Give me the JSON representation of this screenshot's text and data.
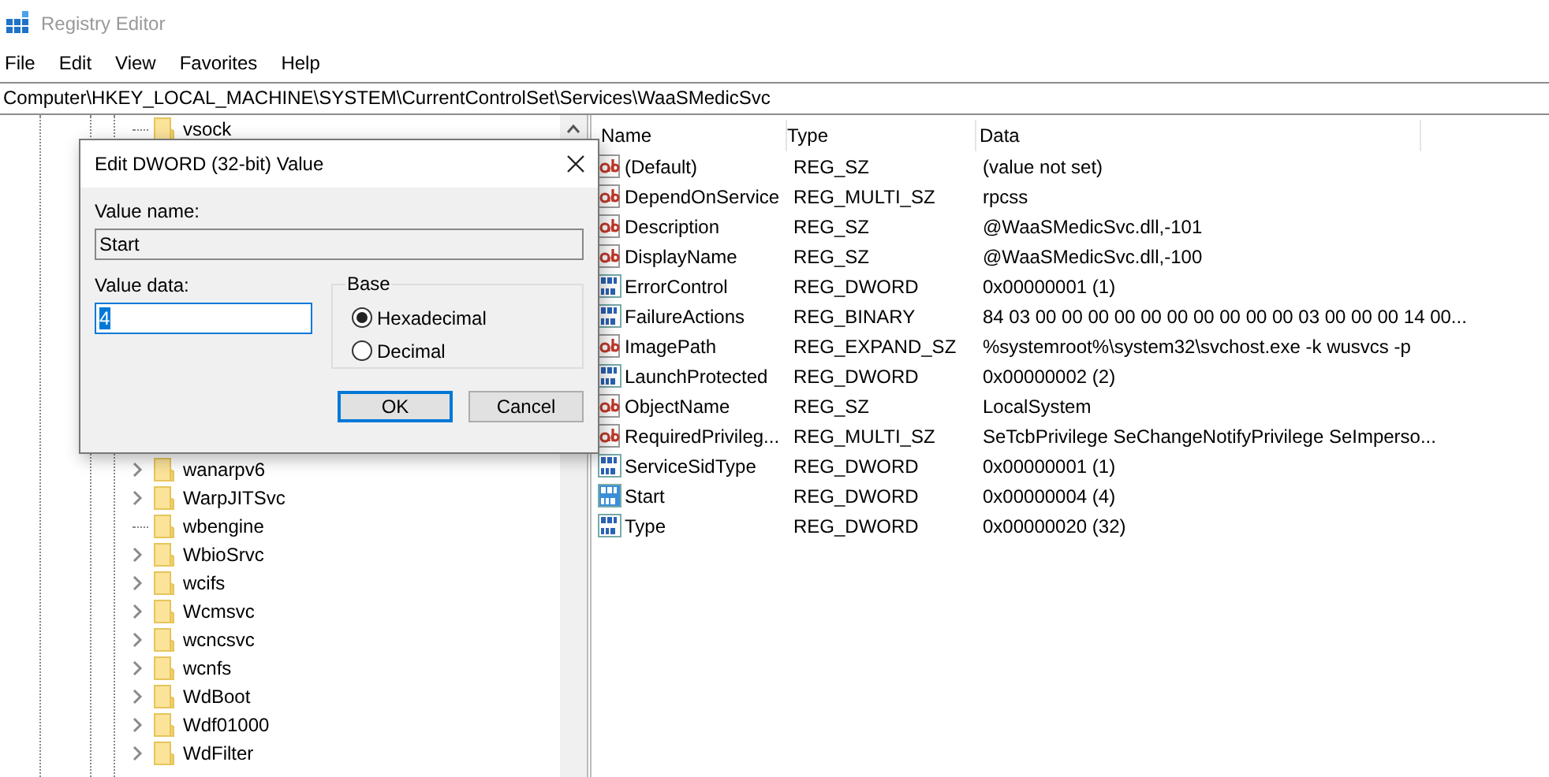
{
  "window": {
    "title": "Registry Editor"
  },
  "menu": [
    "File",
    "Edit",
    "View",
    "Favorites",
    "Help"
  ],
  "address": "Computer\\HKEY_LOCAL_MACHINE\\SYSTEM\\CurrentControlSet\\Services\\WaaSMedicSvc",
  "tree": {
    "items": [
      {
        "label": "vsock",
        "expandable": false
      },
      {
        "label": "wanarpv6",
        "expandable": true
      },
      {
        "label": "WarpJITSvc",
        "expandable": true
      },
      {
        "label": "wbengine",
        "expandable": false
      },
      {
        "label": "WbioSrvc",
        "expandable": true
      },
      {
        "label": "wcifs",
        "expandable": true
      },
      {
        "label": "Wcmsvc",
        "expandable": true
      },
      {
        "label": "wcncsvc",
        "expandable": true
      },
      {
        "label": "wcnfs",
        "expandable": true
      },
      {
        "label": "WdBoot",
        "expandable": true
      },
      {
        "label": "Wdf01000",
        "expandable": true
      },
      {
        "label": "WdFilter",
        "expandable": true
      }
    ]
  },
  "values": {
    "columns": [
      "Name",
      "Type",
      "Data"
    ],
    "rows": [
      {
        "kind": "string",
        "name": "(Default)",
        "type": "REG_SZ",
        "data": "(value not set)",
        "selected": false
      },
      {
        "kind": "string",
        "name": "DependOnService",
        "type": "REG_MULTI_SZ",
        "data": "rpcss",
        "selected": false
      },
      {
        "kind": "string",
        "name": "Description",
        "type": "REG_SZ",
        "data": "@WaaSMedicSvc.dll,-101",
        "selected": false
      },
      {
        "kind": "string",
        "name": "DisplayName",
        "type": "REG_SZ",
        "data": "@WaaSMedicSvc.dll,-100",
        "selected": false
      },
      {
        "kind": "binary",
        "name": "ErrorControl",
        "type": "REG_DWORD",
        "data": "0x00000001 (1)",
        "selected": false
      },
      {
        "kind": "binary",
        "name": "FailureActions",
        "type": "REG_BINARY",
        "data": "84 03 00 00 00 00 00 00 00 00 00 00 03 00 00 00 14 00...",
        "selected": false
      },
      {
        "kind": "string",
        "name": "ImagePath",
        "type": "REG_EXPAND_SZ",
        "data": "%systemroot%\\system32\\svchost.exe -k wusvcs -p",
        "selected": false
      },
      {
        "kind": "binary",
        "name": "LaunchProtected",
        "type": "REG_DWORD",
        "data": "0x00000002 (2)",
        "selected": false
      },
      {
        "kind": "string",
        "name": "ObjectName",
        "type": "REG_SZ",
        "data": "LocalSystem",
        "selected": false
      },
      {
        "kind": "string",
        "name": "RequiredPrivileg...",
        "type": "REG_MULTI_SZ",
        "data": "SeTcbPrivilege SeChangeNotifyPrivilege SeImperso...",
        "selected": false
      },
      {
        "kind": "binary",
        "name": "ServiceSidType",
        "type": "REG_DWORD",
        "data": "0x00000001 (1)",
        "selected": false
      },
      {
        "kind": "binary",
        "name": "Start",
        "type": "REG_DWORD",
        "data": "0x00000004 (4)",
        "selected": true
      },
      {
        "kind": "binary",
        "name": "Type",
        "type": "REG_DWORD",
        "data": "0x00000020 (32)",
        "selected": false
      }
    ]
  },
  "dialog": {
    "title": "Edit DWORD (32-bit) Value",
    "value_name_label": "Value name:",
    "value_name": "Start",
    "value_data_label": "Value data:",
    "value_data": "4",
    "base_label": "Base",
    "bases": [
      {
        "label": "Hexadecimal",
        "selected": true
      },
      {
        "label": "Decimal",
        "selected": false
      }
    ],
    "buttons": [
      {
        "label": "OK",
        "default": true
      },
      {
        "label": "Cancel",
        "default": false
      }
    ]
  }
}
